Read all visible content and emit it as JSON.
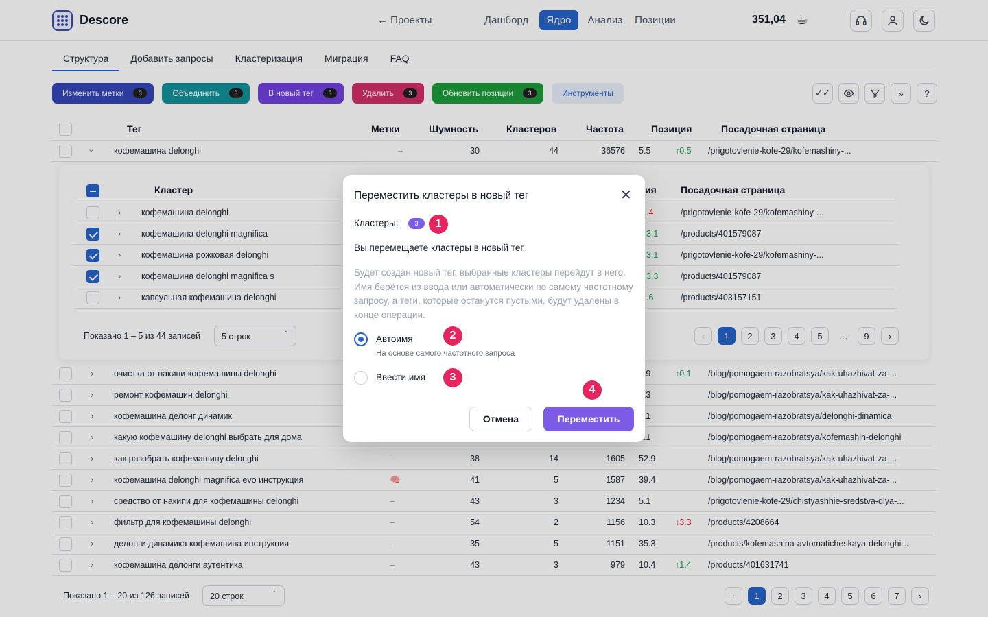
{
  "header": {
    "logo_text": "Descore",
    "back_link": "← Проекты",
    "nav": [
      "Дашборд",
      "Ядро",
      "Анализ",
      "Позиции"
    ],
    "balance": "351,04"
  },
  "tabs": [
    "Структура",
    "Добавить запросы",
    "Кластеризация",
    "Миграция",
    "FAQ"
  ],
  "actions": [
    {
      "label": "Изменить метки",
      "count": "3",
      "color": "#3346b8"
    },
    {
      "label": "Объединить",
      "count": "3",
      "color": "#11939a"
    },
    {
      "label": "В новый тег",
      "count": "3",
      "color": "#7040e0"
    },
    {
      "label": "Удалить",
      "count": "3",
      "color": "#d12e68"
    },
    {
      "label": "Обновить позиции",
      "count": "3",
      "color": "#1e9a3a"
    },
    {
      "label": "Инструменты",
      "count": "",
      "color": "#e8eef7"
    }
  ],
  "table": {
    "headers": [
      "Тег",
      "Метки",
      "Шумность",
      "Кластеров",
      "Частота",
      "Позиция",
      "Посадочная страница"
    ],
    "expanded_row": {
      "tag": "кофемашина delonghi",
      "marks": "–",
      "noise": "30",
      "clusters": "44",
      "freq": "36576",
      "pos": "5.5",
      "delta": "↑0.5",
      "url": "/prigotovlenie-kofe-29/kofemashiny-..."
    },
    "rows": [
      {
        "tag": "очистка от накипи кофемашины delonghi",
        "marks": "",
        "noise": "",
        "clusters": "",
        "freq": "",
        "pos": "0.9",
        "delta": "↑0.1",
        "dir": "up",
        "url": "/blog/pomogaem-razobratsya/kak-uhazhivat-za-..."
      },
      {
        "tag": "ремонт кофемашин delonghi",
        "marks": "",
        "noise": "",
        "clusters": "",
        "freq": "",
        "pos": "4.3",
        "delta": "",
        "dir": "",
        "url": "/blog/pomogaem-razobratsya/kak-uhazhivat-za-..."
      },
      {
        "tag": "кофемашина делонг динамик",
        "marks": "",
        "noise": "",
        "clusters": "",
        "freq": "",
        "pos": "9.1",
        "delta": "",
        "dir": "",
        "url": "/blog/pomogaem-razobratsya/delonghi-dinamica"
      },
      {
        "tag": "какую кофемашину delonghi выбрать для дома",
        "marks": "",
        "noise": "",
        "clusters": "",
        "freq": "",
        "pos": "4.1",
        "delta": "",
        "dir": "",
        "url": "/blog/pomogaem-razobratsya/kofemashin-delonghi"
      },
      {
        "tag": "как разобрать кофемашину delonghi",
        "marks": "–",
        "noise": "38",
        "clusters": "14",
        "freq": "1605",
        "pos": "52.9",
        "delta": "",
        "dir": "",
        "url": "/blog/pomogaem-razobratsya/kak-uhazhivat-za-..."
      },
      {
        "tag": "кофемашина delonghi magnifica evo инструкция",
        "marks": "🧠",
        "noise": "41",
        "clusters": "5",
        "freq": "1587",
        "pos": "39.4",
        "delta": "",
        "dir": "",
        "url": "/blog/pomogaem-razobratsya/kak-uhazhivat-za-..."
      },
      {
        "tag": "средство от накипи для кофемашины delonghi",
        "marks": "–",
        "noise": "43",
        "clusters": "3",
        "freq": "1234",
        "pos": "5.1",
        "delta": "",
        "dir": "",
        "url": "/prigotovlenie-kofe-29/chistyashhie-sredstva-dlya-..."
      },
      {
        "tag": "фильтр для кофемашины delonghi",
        "marks": "–",
        "noise": "54",
        "clusters": "2",
        "freq": "1156",
        "pos": "10.3",
        "delta": "↓3.3",
        "dir": "down",
        "url": "/products/4208664"
      },
      {
        "tag": "делонги динамика кофемашина инструкция",
        "marks": "–",
        "noise": "35",
        "clusters": "5",
        "freq": "1151",
        "pos": "35.3",
        "delta": "",
        "dir": "",
        "url": "/products/kofemashina-avtomaticheskaya-delonghi-..."
      },
      {
        "tag": "кофемашина делонги аутентика",
        "marks": "–",
        "noise": "43",
        "clusters": "3",
        "freq": "979",
        "pos": "10.4",
        "delta": "↑1.4",
        "dir": "up",
        "url": "/products/401631741"
      }
    ],
    "footer": {
      "info": "Показано 1 – 20 из 126 записей",
      "rows_select": "20 строк",
      "pages": [
        "1",
        "2",
        "3",
        "4",
        "5",
        "6",
        "7"
      ]
    }
  },
  "nested": {
    "headers": {
      "cluster": "Кластер",
      "pos_fragment": "ия",
      "url": "Посадочная страница"
    },
    "rows": [
      {
        "name": "кофемашина delonghi",
        "checked": false,
        "delta": ".4",
        "dir": "down",
        "url": "/prigotovlenie-kofe-29/kofemashiny-..."
      },
      {
        "name": "кофемашина delonghi magnifica",
        "checked": true,
        "delta": "3.1",
        "dir": "up",
        "url": "/products/401579087"
      },
      {
        "name": "кофемашина рожковая delonghi",
        "checked": true,
        "delta": "3.1",
        "dir": "up",
        "url": "/prigotovlenie-kofe-29/kofemashiny-..."
      },
      {
        "name": "кофемашина delonghi magnifica s",
        "checked": true,
        "delta": "3.3",
        "dir": "up",
        "url": "/products/401579087"
      },
      {
        "name": "капсульная кофемашина delonghi",
        "checked": false,
        "delta": ".6",
        "dir": "up",
        "url": "/products/403157151"
      }
    ],
    "footer": {
      "info": "Показано 1 – 5 из 44 записей",
      "rows_select": "5 строк",
      "pages": [
        "1",
        "2",
        "3",
        "4",
        "5",
        "…",
        "9"
      ]
    }
  },
  "modal": {
    "title": "Переместить кластеры в новый тег",
    "clusters_label": "Кластеры:",
    "clusters_count": "3",
    "subtitle": "Вы перемещаете кластеры в новый тег.",
    "description": "Будет создан новый тег, выбранные кластеры перейдут в него. Имя берётся из ввода или автоматически по самому частотному запросу, а теги, которые останутся пустыми, будут удалены в конце операции.",
    "option_auto": "Автоимя",
    "option_auto_hint": "На основе самого частотного запроса",
    "option_manual": "Ввести имя",
    "cancel": "Отмена",
    "confirm": "Переместить"
  },
  "markers": [
    "1",
    "2",
    "3",
    "4"
  ]
}
